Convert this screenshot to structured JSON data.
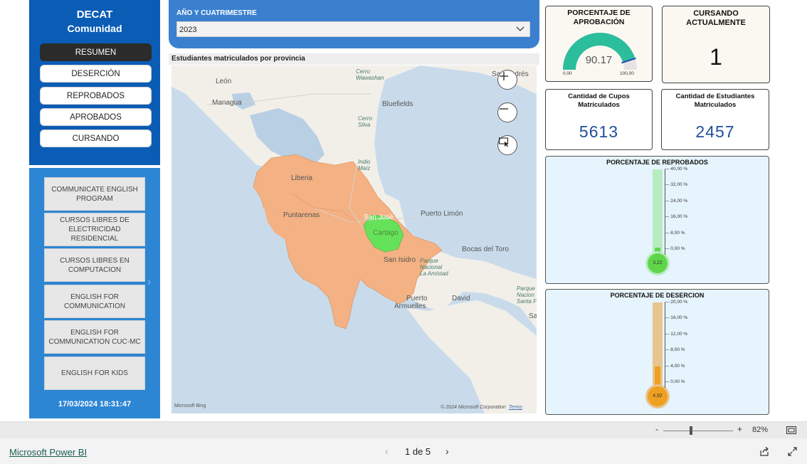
{
  "nav": {
    "title": "DECAT",
    "subtitle": "Comunidad",
    "buttons": [
      "RESUMEN",
      "DESERCIÓN",
      "REPROBADOS",
      "APROBADOS",
      "CURSANDO"
    ],
    "active": "RESUMEN"
  },
  "courses": [
    "COMMUNICATE ENGLISH PROGRAM",
    "CURSOS LIBRES DE ELECTRICIDAD RESIDENCIAL",
    "CURSOS LIBRES EN COMPUTACION",
    "ENGLISH FOR COMMUNICATION",
    "ENGLISH FOR COMMUNICATION CUC-MC",
    "ENGLISH FOR KIDS"
  ],
  "timestamp": "17/03/2024 18:31:47",
  "filter": {
    "label": "AÑO Y CUATRIMESTRE",
    "value": "2023"
  },
  "map": {
    "title": "Estudiantes matriculados por provincia",
    "labels": {
      "leon": "León",
      "managua": "Managua",
      "cerro_wawashan": "Cerro\nWawashan",
      "bluefields": "Bluefields",
      "cerro_silva": "Cerro\nSilva",
      "indio_maiz": "Indio\nMaíz",
      "liberia": "Liberia",
      "puntarenas": "Puntarenas",
      "san_jose": "San José",
      "cartago": "Cartago",
      "puerto_limon": "Puerto Limón",
      "bocas": "Bocas del Toro",
      "san_isidro": "San Isidro",
      "parque": "Parque\nNacional\nLa Amistad",
      "puerto": "Puerto",
      "armuelles": "Armuelles",
      "david": "David",
      "parque2": "Parque\nNacion\nSanta F",
      "sa": "Sa",
      "sandres": "San Andrés"
    },
    "bing": "Microsoft Bing",
    "copyright": "© 2024 Microsoft Corporation",
    "terms": "Terms",
    "region_colors": {
      "province": "#f4b183",
      "highlight": "#66e25a"
    }
  },
  "kpis": {
    "aprobacion": {
      "title": "PORCENTAJE DE APROBACIÓN",
      "value": "90.17",
      "min": "0,00",
      "max": "100,00",
      "fraction": 0.9017,
      "color": "#2bbd9c"
    },
    "cursando": {
      "title": "CURSANDO ACTUALMENTE",
      "value": "1"
    },
    "cupos": {
      "title": "Cantidad de Cupos Matriculados",
      "value": "5613"
    },
    "estudiantes": {
      "title": "Cantidad de Estudiantes Matriculados",
      "value": "2457"
    }
  },
  "reprobados": {
    "title": "PORCENTAJE DE REPROBADOS",
    "ticks": [
      "40,00 %",
      "32,00 %",
      "24,00 %",
      "16,00 %",
      "8,00 %",
      "0,00 %"
    ],
    "max": 40,
    "value": 3.22,
    "value_label": "3,22",
    "fill_color": "#5fd64a",
    "track_color": "#b7ecc0"
  },
  "desercion": {
    "title": "PORCENTAJE DE DESERCION",
    "ticks": [
      "20,00 %",
      "16,00 %",
      "12,00 %",
      "8,00 %",
      "4,00 %",
      "0,00 %"
    ],
    "max": 20,
    "value": 4.92,
    "value_label": "4,92",
    "fill_color": "#f0a020",
    "track_color": "#e8c48e"
  },
  "zoom": {
    "minus": "-",
    "plus": "+",
    "percent": "82%"
  },
  "footer": {
    "link": "Microsoft Power BI",
    "pager": "1 de 5",
    "prev": "‹",
    "next": "›"
  }
}
